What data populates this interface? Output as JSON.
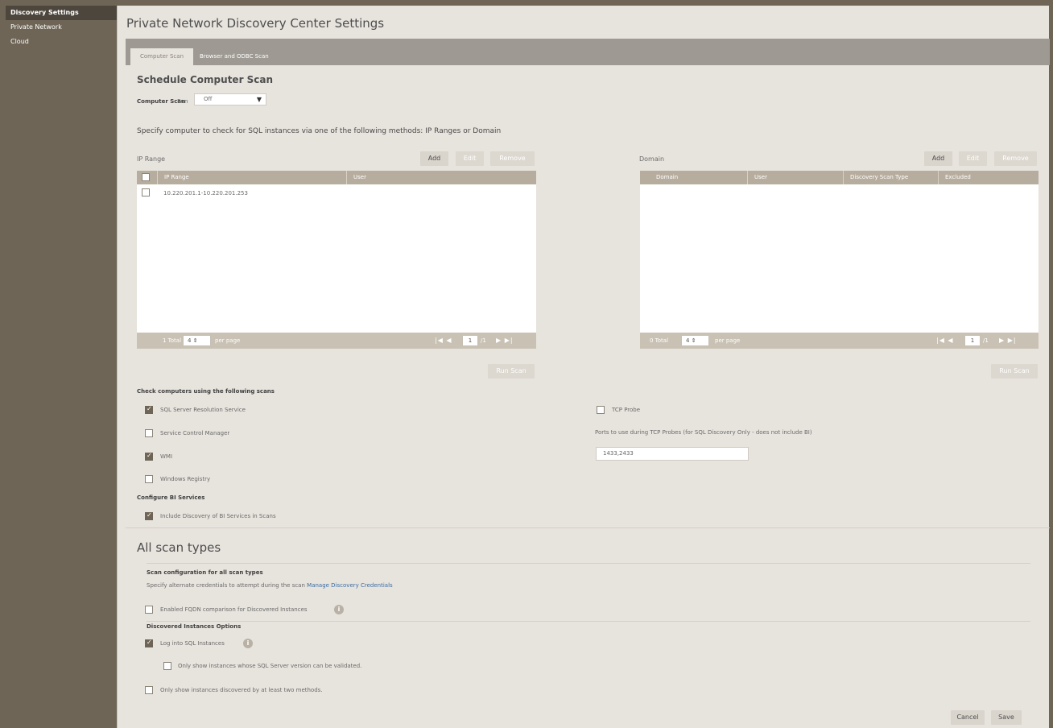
{
  "sidebar": {
    "items": [
      {
        "label": "Discovery Settings"
      },
      {
        "label": "Private Network"
      },
      {
        "label": "Cloud"
      }
    ]
  },
  "page": {
    "title": "Private Network Discovery Center Settings",
    "tabs": [
      {
        "label": "Computer Scan"
      },
      {
        "label": "Browser and ODBC Scan"
      }
    ]
  },
  "schedule": {
    "heading": "Schedule Computer Scan",
    "label": "Computer Scan",
    "run_label": "Run",
    "run_value": "Off",
    "description": "Specify computer to check for SQL instances via one of the following methods: IP Ranges or Domain"
  },
  "ip_range": {
    "title": "IP Range",
    "add": "Add",
    "edit": "Edit",
    "remove": "Remove",
    "columns": [
      "IP Range",
      "User"
    ],
    "rows": [
      {
        "ip": "10.220.201.1-10.220.201.253",
        "user": ""
      }
    ],
    "total": "1 Total",
    "per_page_value": "4",
    "per_page_label": "per page",
    "page_nav_left": "|◀ ◀",
    "page": "1",
    "page_of": "/1",
    "page_nav_right": "▶ ▶|",
    "run_scan": "Run Scan"
  },
  "domain": {
    "title": "Domain",
    "add": "Add",
    "edit": "Edit",
    "remove": "Remove",
    "columns": [
      "Domain",
      "User",
      "Discovery Scan Type",
      "Excluded"
    ],
    "total": "0 Total",
    "per_page_value": "4",
    "per_page_label": "per page",
    "page_nav_left": "|◀ ◀",
    "page": "1",
    "page_of": "/1",
    "page_nav_right": "▶ ▶|",
    "run_scan": "Run Scan"
  },
  "scans": {
    "heading": "Check computers using the following scans",
    "options": [
      {
        "label": "SQL Server Resolution Service",
        "checked": true
      },
      {
        "label": "Service Control Manager",
        "checked": false
      },
      {
        "label": "WMI",
        "checked": true
      },
      {
        "label": "Windows Registry",
        "checked": false
      }
    ],
    "tcp_probe": "TCP Probe",
    "ports_label": "Ports to use during TCP Probes (for SQL Discovery Only - does not include BI)",
    "ports_value": "1433,2433"
  },
  "bi": {
    "heading": "Configure BI Services",
    "option": "Include Discovery of BI Services in Scans"
  },
  "all_scan": {
    "title": "All scan types",
    "config_heading": "Scan configuration for all scan types",
    "config_desc": "Specify alternate credentials to attempt during the scan",
    "config_link": "Manage Discovery Credentials",
    "fqdn": "Enabled FQDN comparison for Discovered Instances",
    "instances_heading": "Discovered Instances Options",
    "log_into": "Log into SQL Instances",
    "only_validated": "Only show instances whose SQL Server version can be validated.",
    "only_two": "Only show instances discovered by at least two methods."
  },
  "actions": {
    "cancel": "Cancel",
    "save": "Save"
  }
}
